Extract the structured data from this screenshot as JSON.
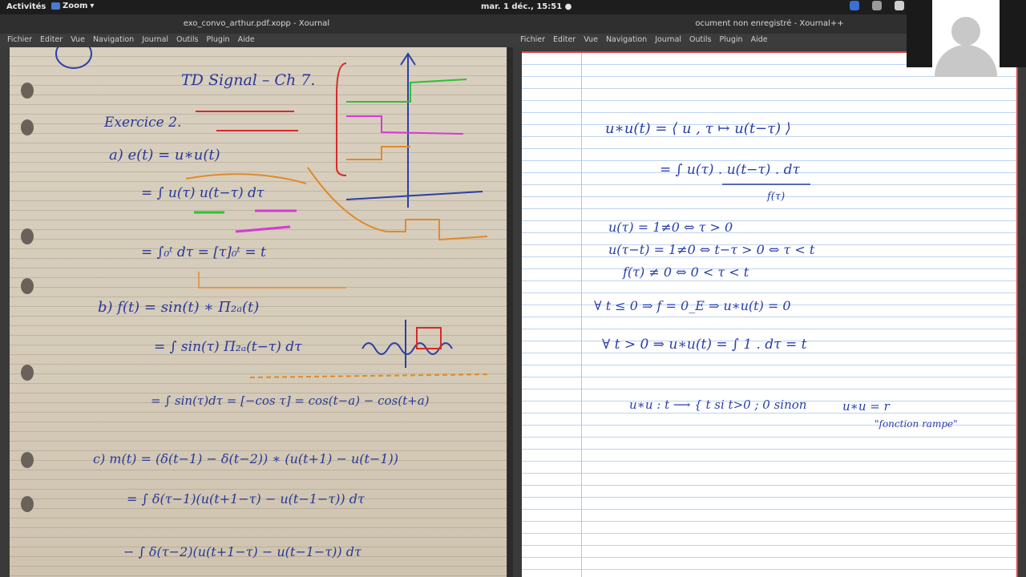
{
  "topbar": {
    "activities": "Activités",
    "zoom": "Zoom",
    "clock": "mar.  1 déc., 15:51 ●"
  },
  "left_window": {
    "title": "exo_convo_arthur.pdf.xopp - Xournal",
    "menu": [
      "Fichier",
      "Editer",
      "Vue",
      "Navigation",
      "Journal",
      "Outils",
      "Plugin",
      "Aide"
    ],
    "notes": {
      "title": "TD Signal – Ch 7.",
      "exercise": "Exercice 2.",
      "a": "a)  e(t) = u∗u(t)",
      "a_line2": "= ∫ u(τ) u(t−τ) dτ",
      "a_line3": "= ∫₀ᵗ dτ = [τ]₀ᵗ = t",
      "b": "b)  f(t) = sin(t) ∗ Π₂ₐ(t)",
      "b_line2": "= ∫ sin(τ) Π₂ₐ(t−τ) dτ",
      "b_line3": "= ∫ sin(τ)dτ = [−cos τ] = cos(t−a) − cos(t+a)",
      "c": "c)  m(t) = (δ(t−1) − δ(t−2)) ∗ (u(t+1) − u(t−1))",
      "c_line2": "= ∫ δ(τ−1)(u(t+1−τ) − u(t−1−τ)) dτ",
      "c_line3": "− ∫ δ(τ−2)(u(t+1−τ) − u(t−1−τ)) dτ"
    }
  },
  "right_window": {
    "title": "ocument non enregistré - Xournal++",
    "menu": [
      "Fichier",
      "Editer",
      "Vue",
      "Navigation",
      "Journal",
      "Outils",
      "Plugin",
      "Aide"
    ],
    "notes": {
      "line1": "u∗u(t) = ⟨ u , τ ↦ u(t−τ) ⟩",
      "line2": "= ∫ u(τ) . u(t−τ) . dτ",
      "line2_sub": "f(τ)",
      "line3": "u(τ) = 1≠0   ⇔   τ > 0",
      "line4": "u(τ−t) = 1≠0   ⇔   t−τ > 0   ⇔   τ < t",
      "line5": "f(τ) ≠ 0  ⇔   0 < τ < t",
      "line6": "∀ t ≤ 0  ⇒   f = 0_E   ⇒   u∗u(t) = 0",
      "line7": "∀ t > 0  ⇒   u∗u(t) = ∫ 1 . dτ = t",
      "line8": "u∗u : t ⟶ { t si t>0 ; 0 sinon",
      "line9": "u∗u = r",
      "line10": "\"fonction rampe\""
    }
  },
  "colors": {
    "ink_blue": "#2a3fa8",
    "ink_red": "#d42a2a",
    "ink_orange": "#e08a2a",
    "ink_green": "#30c030",
    "ink_magenta": "#d43ad4"
  }
}
